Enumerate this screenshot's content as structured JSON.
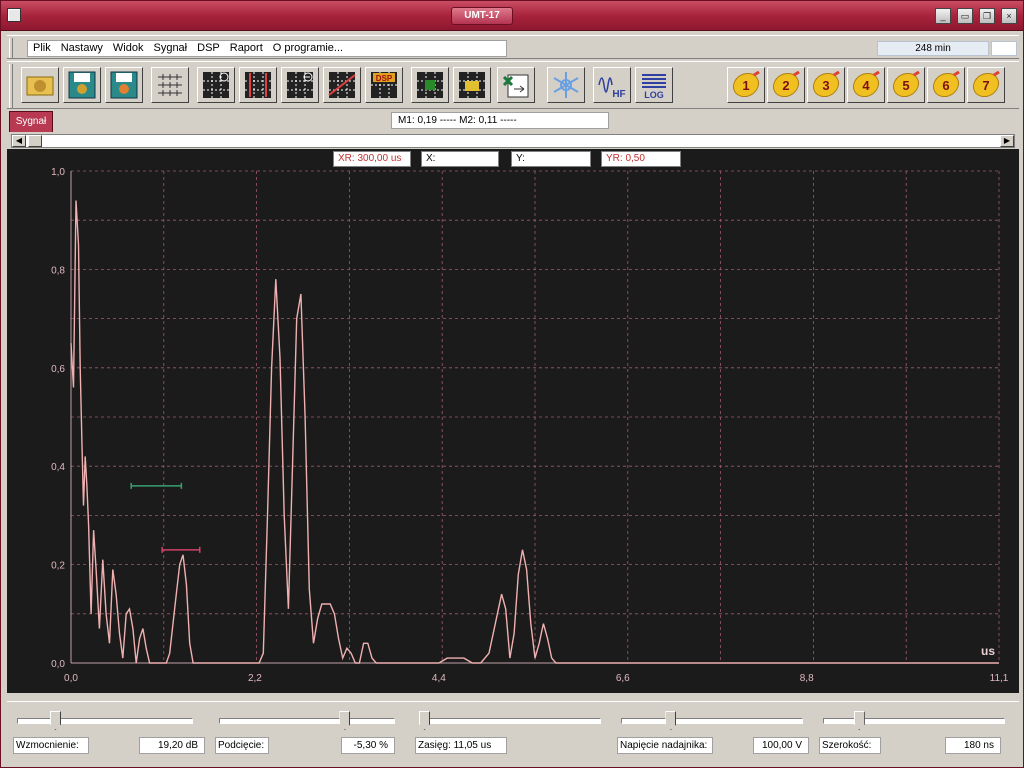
{
  "window": {
    "title": "UMT-17",
    "minimize": "_",
    "restore": "▭",
    "maximize": "❐",
    "close": "×",
    "colors": {
      "titlebar": "#a8243c",
      "plot_bg": "#1b1b1b",
      "trace": "#f0b0b0",
      "grid": "#a05a6a"
    }
  },
  "menubar": {
    "items": [
      "Plik",
      "Nastawy",
      "Widok",
      "Sygnał",
      "DSP",
      "Raport",
      "O programie..."
    ],
    "time_display": "248 min"
  },
  "toolbar": {
    "buttons": [
      {
        "icon": "open-folder-icon"
      },
      {
        "icon": "save-disk-icon"
      },
      {
        "icon": "save-as-disk-icon"
      },
      {
        "icon": "gates-icon"
      },
      {
        "icon": "zoom-grid-icon"
      },
      {
        "icon": "grid-zoom-in-icon"
      },
      {
        "icon": "grid-zoom-out-icon"
      },
      {
        "icon": "curve-grid-icon"
      },
      {
        "icon": "dsp-grid-icon"
      },
      {
        "icon": "envelope-icon"
      },
      {
        "icon": "peak-icon"
      },
      {
        "icon": "export-excel-icon"
      },
      {
        "icon": "freeze-icon"
      },
      {
        "icon": "hf-icon",
        "label": "HF"
      },
      {
        "icon": "log-icon",
        "label": "LOG"
      }
    ],
    "presets": [
      "1",
      "2",
      "3",
      "4",
      "5",
      "6",
      "7"
    ]
  },
  "tabs": {
    "signal": "Sygnał"
  },
  "markers": {
    "text": "M1: 0,19  -----     M2: 0,11  -----"
  },
  "readouts": {
    "xr": "XR: 300,00 us",
    "x": "X:",
    "y": "Y:",
    "yr": "YR: 0,50"
  },
  "chart_data": {
    "type": "line",
    "xlabel": "us",
    "x_ticks": [
      "0,0",
      "2,2",
      "4,4",
      "6,6",
      "8,8",
      "11,1"
    ],
    "x_tick_values": [
      0,
      2.2,
      4.4,
      6.6,
      8.8,
      11.1
    ],
    "y_ticks": [
      "0,0",
      "0,2",
      "0,4",
      "0,6",
      "0,8",
      "1,0"
    ],
    "xlim": [
      0,
      11.1
    ],
    "ylim": [
      0,
      1.0
    ],
    "grid": true,
    "gates": [
      {
        "x0": 0.72,
        "x1": 1.32,
        "y": 0.36,
        "color": "#3aa070"
      },
      {
        "x0": 1.09,
        "x1": 1.54,
        "y": 0.23,
        "color": "#d0406a"
      }
    ],
    "series": [
      {
        "x": [
          0.0,
          0.03,
          0.06,
          0.09,
          0.11,
          0.13,
          0.15,
          0.17,
          0.19,
          0.21,
          0.24,
          0.27,
          0.3,
          0.34,
          0.38,
          0.42,
          0.46,
          0.5,
          0.54,
          0.58,
          0.62,
          0.66,
          0.7,
          0.74,
          0.78,
          0.82,
          0.86,
          0.9,
          0.94,
          0.98,
          1.02,
          1.06,
          1.1,
          1.14,
          1.18,
          1.22,
          1.26,
          1.3,
          1.34,
          1.38,
          1.42,
          1.46,
          1.5,
          1.55,
          1.6,
          1.7,
          1.8,
          1.9,
          2.0,
          2.05,
          2.1,
          2.15,
          2.2,
          2.25,
          2.3,
          2.35,
          2.4,
          2.45,
          2.5,
          2.55,
          2.6,
          2.65,
          2.7,
          2.75,
          2.8,
          2.85,
          2.9,
          2.95,
          3.0,
          3.05,
          3.1,
          3.15,
          3.2,
          3.25,
          3.3,
          3.35,
          3.4,
          3.45,
          3.5,
          3.55,
          3.6,
          3.65,
          3.7,
          3.75,
          3.8,
          3.85,
          3.9,
          3.95,
          4.0,
          4.1,
          4.2,
          4.3,
          4.4,
          4.5,
          4.6,
          4.7,
          4.8,
          4.9,
          5.0,
          5.1,
          5.15,
          5.2,
          5.25,
          5.3,
          5.35,
          5.4,
          5.45,
          5.5,
          5.55,
          5.6,
          5.65,
          5.7,
          5.75,
          5.8,
          5.85,
          5.9,
          5.95,
          6.0,
          6.05,
          6.1,
          6.2,
          6.3,
          6.4,
          6.5,
          6.6,
          6.8,
          7.0,
          7.2,
          7.4,
          7.6,
          7.8,
          8.0,
          8.1,
          8.2,
          8.3,
          8.4,
          8.5,
          8.6,
          8.7,
          8.8,
          8.9,
          9.0,
          9.1,
          9.2,
          9.4,
          9.6,
          9.8,
          10.0,
          10.2,
          10.4,
          10.6,
          10.8,
          11.1
        ],
        "y": [
          0.65,
          0.56,
          0.94,
          0.85,
          0.6,
          0.45,
          0.32,
          0.42,
          0.36,
          0.28,
          0.1,
          0.27,
          0.19,
          0.07,
          0.21,
          0.1,
          0.04,
          0.19,
          0.14,
          0.06,
          0.01,
          0.1,
          0.11,
          0.07,
          0.0,
          0.05,
          0.07,
          0.03,
          0.0,
          0.0,
          0.0,
          0.0,
          0.0,
          0.0,
          0.02,
          0.08,
          0.14,
          0.2,
          0.22,
          0.16,
          0.04,
          0.0,
          0.0,
          0.0,
          0.0,
          0.0,
          0.0,
          0.0,
          0.0,
          0.0,
          0.0,
          0.0,
          0.0,
          0.0,
          0.02,
          0.3,
          0.6,
          0.78,
          0.62,
          0.3,
          0.11,
          0.4,
          0.7,
          0.75,
          0.5,
          0.15,
          0.04,
          0.09,
          0.12,
          0.12,
          0.12,
          0.1,
          0.05,
          0.01,
          0.03,
          0.02,
          0.0,
          0.0,
          0.04,
          0.04,
          0.01,
          0.0,
          0.0,
          0.0,
          0.0,
          0.0,
          0.0,
          0.0,
          0.0,
          0.0,
          0.0,
          0.0,
          0.0,
          0.01,
          0.01,
          0.01,
          0.0,
          0.0,
          0.02,
          0.1,
          0.14,
          0.11,
          0.01,
          0.06,
          0.18,
          0.23,
          0.19,
          0.08,
          0.01,
          0.04,
          0.08,
          0.05,
          0.01,
          0.0,
          0.0,
          0.0,
          0.0,
          0.0,
          0.0,
          0.0,
          0.0,
          0.0,
          0.0,
          0.0,
          0.0,
          0.0,
          0.0,
          0.0,
          0.0,
          0.0,
          0.0,
          0.0,
          0.0,
          0.0,
          0.0,
          0.0,
          0.0,
          0.0,
          0.0,
          0.0,
          0.0,
          0.0,
          0.0,
          0.0,
          0.0,
          0.0,
          0.0,
          0.0,
          0.0,
          0.0,
          0.0,
          0.0,
          0.0
        ]
      }
    ]
  },
  "controls": [
    {
      "label": "Wzmocnienie:",
      "value": "19,20 dB",
      "level": 0.2
    },
    {
      "label": "Podcięcie:",
      "value": "-5,30 %",
      "level": 0.73
    },
    {
      "label": "Zasięg: 11,05  us",
      "value": "",
      "level": 0.0
    },
    {
      "label": "Napięcie nadajnika:",
      "value": "100,00 V",
      "level": 0.26
    },
    {
      "label": "Szerokość:",
      "value": "180 ns",
      "level": 0.18
    }
  ]
}
